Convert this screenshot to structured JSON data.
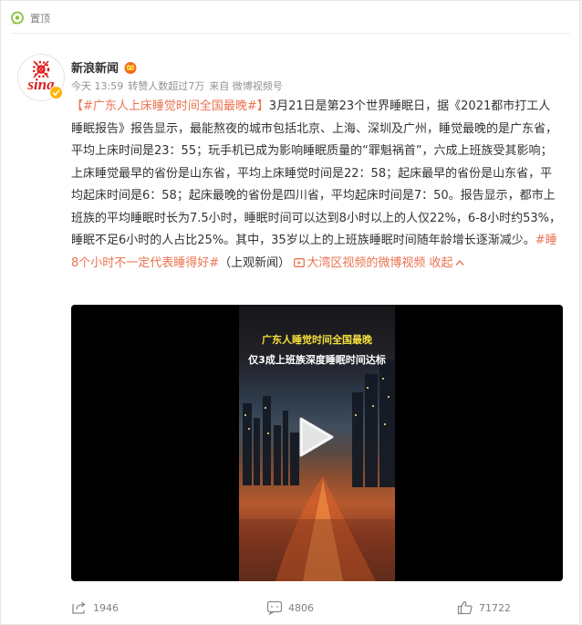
{
  "pin": {
    "label": "置顶"
  },
  "author": {
    "name": "新浪新闻",
    "avatar_text": "sina"
  },
  "meta": {
    "time": "今天 13:59",
    "likes": "转赞人数超过7万",
    "source": "来自 微博视频号"
  },
  "post": {
    "hashtag1": "【#广东人上床睡觉时间全国最晚#】",
    "body": "3月21日是第23个世界睡眠日，据《2021都市打工人睡眠报告》报告显示，最能熬夜的城市包括北京、上海、深圳及广州，睡觉最晚的是广东省，平均上床时间是23：55；玩手机已成为影响睡眠质量的“罪魁祸首”，六成上班族受其影响；上床睡觉最早的省份是山东省，平均上床睡觉时间是22：58；起床最早的省份是山东省，平均起床时间是6：58；起床最晚的省份是四川省，平均起床时间是7：50。报告显示，都市上班族的平均睡眠时长为7.5小时，睡眠时间可以达到8小时以上的人仅22%，6-8小时约53%，睡眠不足6小时的人占比25%。其中，35岁以上的上班族睡眠时间随年龄增长逐渐减少。",
    "hashtag2": "#睡8个小时不一定代表睡得好#",
    "source_note": "（上观新闻）",
    "video_link": "大湾区视频的微博视频",
    "collapse": "收起"
  },
  "video": {
    "caption1": "广东人睡觉时间全国最晚",
    "caption2": "仅3成上班族深度睡眠时间达标"
  },
  "actions": {
    "repost": "1946",
    "comment": "4806",
    "like": "71722"
  },
  "colors": {
    "accent": "#eb7350",
    "verified": "#ffb400",
    "pin_green": "#8ac33b"
  }
}
